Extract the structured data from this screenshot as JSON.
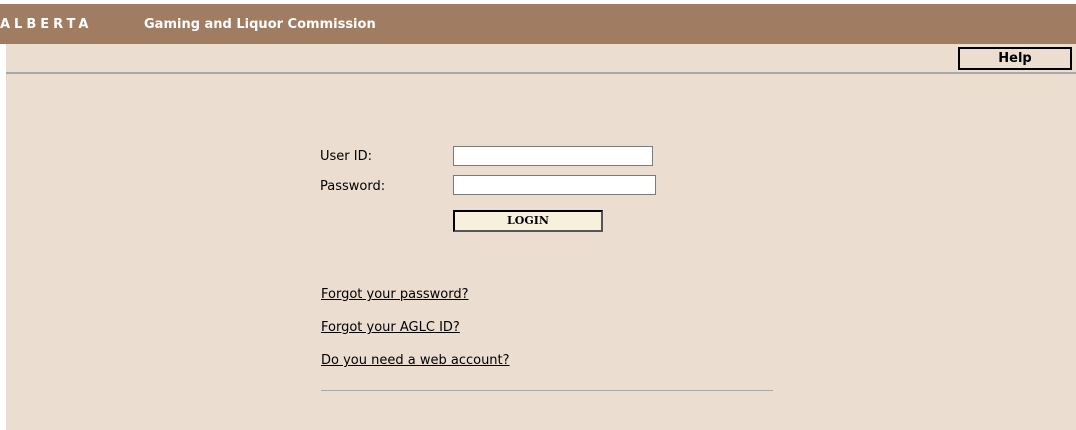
{
  "header": {
    "brand": "ALBERTA",
    "organization": "Gaming and Liquor Commission"
  },
  "toolbar": {
    "help_label": "Help"
  },
  "login_form": {
    "user_id_label": "User ID:",
    "user_id_value": "",
    "password_label": "Password:",
    "password_value": "",
    "login_button_label": "LOGIN"
  },
  "links": {
    "forgot_password": "Forgot your password?",
    "forgot_id": "Forgot your AGLC ID?",
    "need_account": "Do you need a web account?"
  },
  "colors": {
    "header_background": "#a07d62",
    "content_background": "#ebddd0",
    "button_background": "#f7f0dc"
  }
}
